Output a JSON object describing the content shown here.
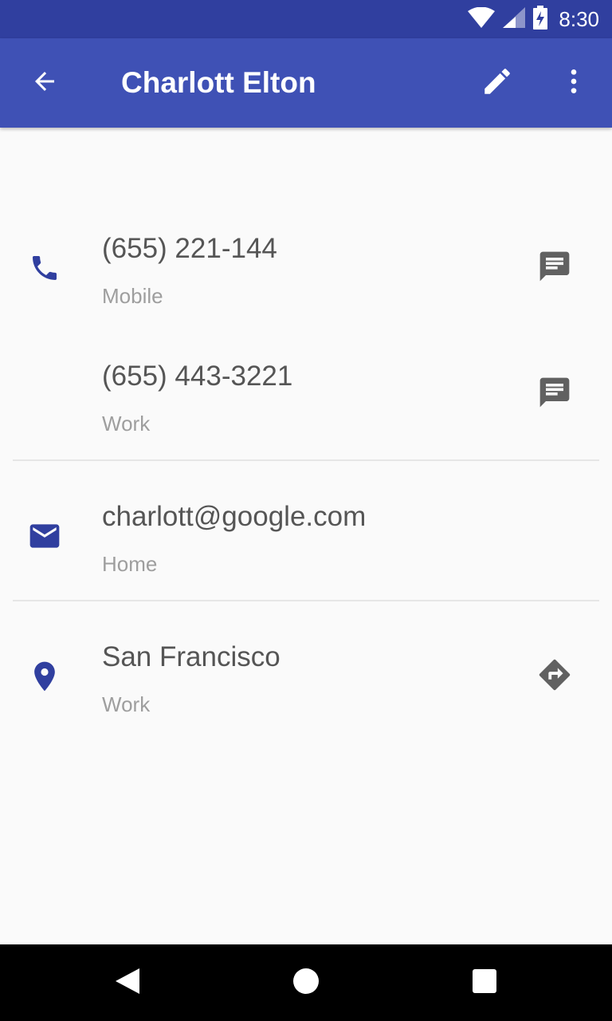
{
  "status_bar": {
    "time": "8:30",
    "icons": [
      "wifi-icon",
      "cell-signal-icon",
      "battery-charging-icon"
    ]
  },
  "app_bar": {
    "title": "Charlott Elton",
    "icons": [
      "back-arrow-icon",
      "edit-pencil-icon",
      "more-vert-icon"
    ]
  },
  "colors": {
    "status_bar": "#303f9f",
    "app_bar": "#3f51b5",
    "accent_icon": "#303f9f",
    "action_icon": "#616161",
    "background": "#fafafa"
  },
  "contact": {
    "phones": [
      {
        "number": "(655) 221-144",
        "label": "Mobile",
        "action_icon": "message-icon"
      },
      {
        "number": "(655) 443-3221",
        "label": "Work",
        "action_icon": "message-icon"
      }
    ],
    "email": {
      "address": "charlott@google.com",
      "label": "Home"
    },
    "address": {
      "place": "San Francisco",
      "label": "Work",
      "action_icon": "directions-icon"
    }
  },
  "nav_bar": {
    "icons": [
      "nav-back-icon",
      "nav-home-icon",
      "nav-recents-icon"
    ]
  }
}
